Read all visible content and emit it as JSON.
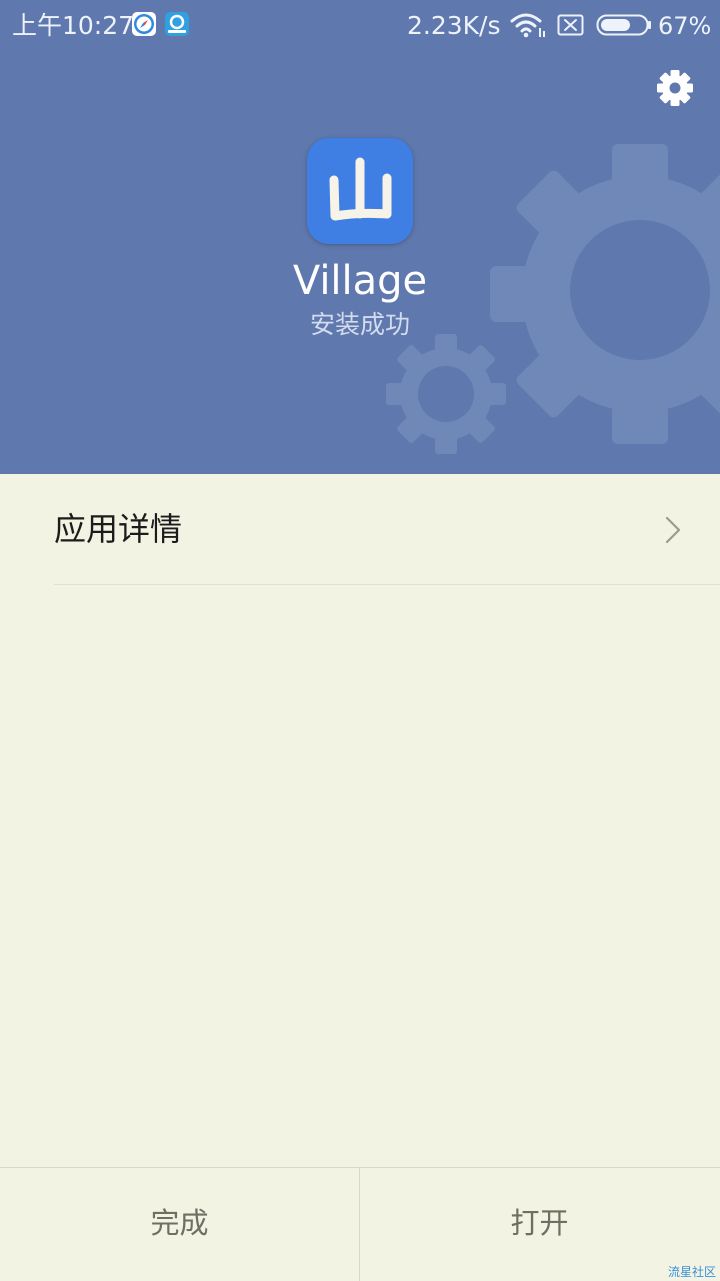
{
  "status_bar": {
    "time": "上午10:27",
    "network_speed": "2.23K/s",
    "battery_percent": "67%",
    "battery_level": 0.67,
    "notification_icons": [
      "compass-app-icon",
      "qq-browser-icon"
    ],
    "system_icons": [
      "wifi-icon",
      "no-sim-icon",
      "battery-icon"
    ]
  },
  "header": {
    "background_color": "#5f78ad",
    "app": {
      "icon_glyph": "山",
      "icon_color": "#3f7fe3",
      "name": "Village",
      "status": "安装成功"
    },
    "settings_icon": "gear-icon"
  },
  "details": {
    "label": "应用详情",
    "chevron_icon": "chevron-right-icon"
  },
  "bottom_bar": {
    "done_label": "完成",
    "open_label": "打开"
  },
  "watermark": "流星社区"
}
